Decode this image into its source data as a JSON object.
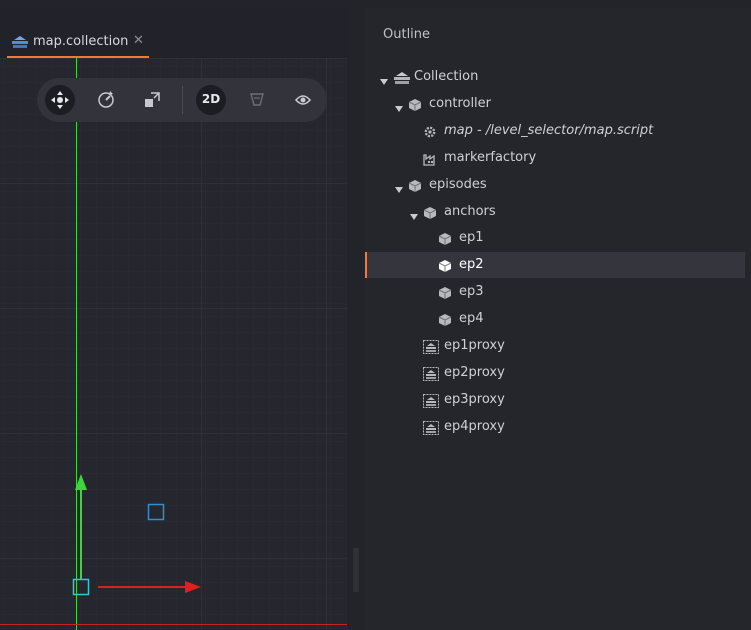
{
  "tab": {
    "label": "map.collection",
    "close": "✕",
    "accent_color": "#f1783a"
  },
  "toolbar": {
    "tools": [
      {
        "name": "move-tool",
        "icon": "move-icon",
        "active": true
      },
      {
        "name": "rotate-tool",
        "icon": "rotate-icon",
        "active": false
      },
      {
        "name": "scale-tool",
        "icon": "scale-icon",
        "active": false
      },
      {
        "name": "2d-toggle",
        "label": "2D",
        "active": true
      },
      {
        "name": "camera-tool",
        "icon": "perspective-camera-icon",
        "active": false
      },
      {
        "name": "visibility-tool",
        "icon": "eye-icon",
        "active": false
      }
    ]
  },
  "viewport": {
    "colors": {
      "x_axis": "#e02020",
      "y_axis": "#3ed43e",
      "selection": "#2f8fd6",
      "pivot": "#2ec9d2"
    }
  },
  "outline": {
    "title": "Outline",
    "items": [
      {
        "label": "Collection",
        "depth": 0,
        "expanded": true,
        "icon": "collection-icon",
        "italic": false,
        "selected": false
      },
      {
        "label": "controller",
        "depth": 1,
        "expanded": true,
        "icon": "game-object-icon",
        "italic": false,
        "selected": false
      },
      {
        "label": "map - /level_selector/map.script",
        "depth": 2,
        "expanded": null,
        "icon": "script-gear-icon",
        "italic": true,
        "selected": false
      },
      {
        "label": "markerfactory",
        "depth": 2,
        "expanded": null,
        "icon": "factory-icon",
        "italic": false,
        "selected": false
      },
      {
        "label": "episodes",
        "depth": 1,
        "expanded": true,
        "icon": "game-object-icon",
        "italic": false,
        "selected": false
      },
      {
        "label": "anchors",
        "depth": 2,
        "expanded": true,
        "icon": "game-object-icon",
        "italic": false,
        "selected": false
      },
      {
        "label": "ep1",
        "depth": 3,
        "expanded": null,
        "icon": "game-object-icon",
        "italic": false,
        "selected": false
      },
      {
        "label": "ep2",
        "depth": 3,
        "expanded": null,
        "icon": "game-object-icon",
        "italic": false,
        "selected": true
      },
      {
        "label": "ep3",
        "depth": 3,
        "expanded": null,
        "icon": "game-object-icon",
        "italic": false,
        "selected": false
      },
      {
        "label": "ep4",
        "depth": 3,
        "expanded": null,
        "icon": "game-object-icon",
        "italic": false,
        "selected": false
      },
      {
        "label": "ep1proxy",
        "depth": 2,
        "expanded": null,
        "icon": "collection-proxy-icon",
        "italic": false,
        "selected": false
      },
      {
        "label": "ep2proxy",
        "depth": 2,
        "expanded": null,
        "icon": "collection-proxy-icon",
        "italic": false,
        "selected": false
      },
      {
        "label": "ep3proxy",
        "depth": 2,
        "expanded": null,
        "icon": "collection-proxy-icon",
        "italic": false,
        "selected": false
      },
      {
        "label": "ep4proxy",
        "depth": 2,
        "expanded": null,
        "icon": "collection-proxy-icon",
        "italic": false,
        "selected": false
      }
    ]
  }
}
